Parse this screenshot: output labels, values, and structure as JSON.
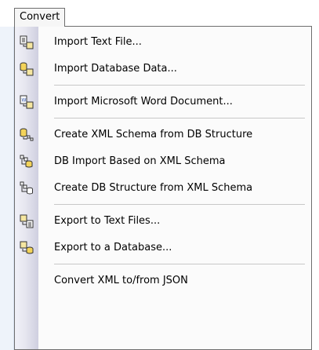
{
  "menubar": {
    "title": "Convert"
  },
  "menu": {
    "items": [
      {
        "label": "Import Text File...",
        "icon": "import-text-icon",
        "group": 1
      },
      {
        "label": "Import Database Data...",
        "icon": "import-db-icon",
        "group": 1
      },
      {
        "label": "Import Microsoft Word Document...",
        "icon": "import-word-icon",
        "group": 2
      },
      {
        "label": "Create XML Schema from DB Structure",
        "icon": "create-schema-icon",
        "group": 3
      },
      {
        "label": "DB Import Based on XML Schema",
        "icon": "db-import-schema-icon",
        "group": 3
      },
      {
        "label": "Create DB Structure from XML Schema",
        "icon": "create-db-structure-icon",
        "group": 3
      },
      {
        "label": "Export to Text Files...",
        "icon": "export-text-icon",
        "group": 4
      },
      {
        "label": "Export to a Database...",
        "icon": "export-db-icon",
        "group": 4
      },
      {
        "label": "Convert XML to/from JSON",
        "icon": "convert-json-icon",
        "group": 5
      }
    ]
  },
  "colors": {
    "gutter_top": "#f1f1f8",
    "gutter_bottom": "#cfcfe0",
    "menu_border": "#6e6e6e",
    "separator": "#c8c8c8"
  }
}
